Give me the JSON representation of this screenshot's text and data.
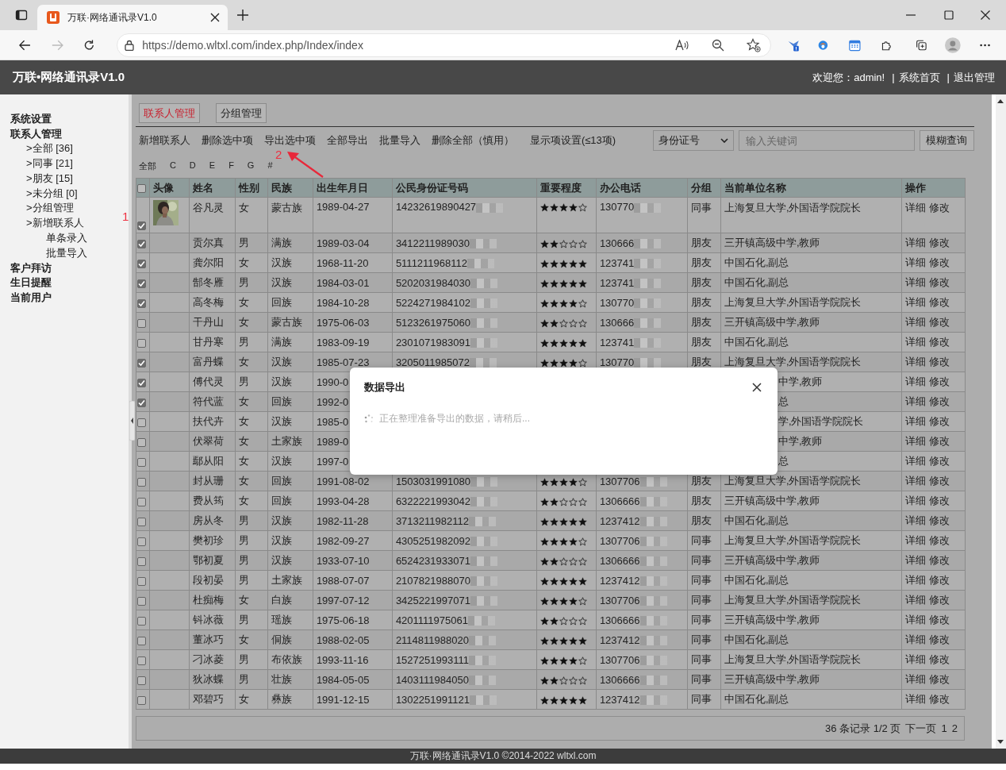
{
  "browser": {
    "tab_title": "万联·网络通讯录V1.0",
    "url": "https://demo.wltxl.com/index.php/Index/index"
  },
  "header": {
    "title": "万联•网络通讯录V1.0",
    "welcome": "欢迎您：admin!",
    "links": [
      {
        "separator": "|",
        "label": "系统首页"
      },
      {
        "separator": "|",
        "label": "退出管理"
      }
    ]
  },
  "sidebar": {
    "sections": [
      {
        "label": "系统设置"
      },
      {
        "label": "联系人管理",
        "children": [
          {
            "label": ">全部 [36]"
          },
          {
            "label": ">同事 [21]"
          },
          {
            "label": ">朋友 [15]"
          },
          {
            "label": ">未分组 [0]"
          },
          {
            "label": ">分组管理"
          },
          {
            "label": ">新增联系人",
            "children": [
              {
                "label": "单条录入"
              },
              {
                "label": "批量导入"
              }
            ]
          }
        ]
      },
      {
        "label": "客户拜访"
      },
      {
        "label": "生日提醒"
      },
      {
        "label": "当前用户"
      }
    ]
  },
  "annotations": [
    {
      "text": "1"
    },
    {
      "text": "2"
    }
  ],
  "tabs": [
    {
      "label": "联系人管理",
      "selected": true
    },
    {
      "label": "分组管理",
      "selected": false
    }
  ],
  "actions": [
    "新增联系人",
    "删除选中项",
    "导出选中项",
    "全部导出",
    "批量导入",
    "删除全部（慎用）",
    "显示项设置(≤13项)"
  ],
  "search": {
    "field": "身份证号",
    "placeholder": "输入关键词",
    "button": "模糊查询"
  },
  "letters": [
    "全部",
    "C",
    "D",
    "E",
    "F",
    "G",
    "#"
  ],
  "table": {
    "select_all": {
      "checked": false
    },
    "columns": [
      "头像",
      "姓名",
      "性别",
      "民族",
      "出生年月日",
      "公民身份证号码",
      "重要程度",
      "办公电话",
      "分组",
      "当前单位名称",
      "操作"
    ],
    "rows": [
      {
        "checked": true,
        "name": "谷凡灵",
        "gender": "女",
        "ethnicity": "蒙古族",
        "birth": "1989-04-27",
        "id_number": "14232619890427",
        "stars": 4,
        "phone": "130770",
        "group": "同事",
        "unit": "上海复旦大学,外国语学院院长",
        "actions": [
          "详细",
          "修改"
        ]
      },
      {
        "checked": true,
        "name": "贡尔真",
        "gender": "男",
        "ethnicity": "满族",
        "birth": "1989-03-04",
        "id_number": "3412211989030",
        "stars": 2,
        "phone": "130666",
        "group": "朋友",
        "unit": "三开镇高级中学,教师",
        "actions": [
          "详细",
          "修改"
        ]
      },
      {
        "checked": true,
        "name": "龚尔阳",
        "gender": "女",
        "ethnicity": "汉族",
        "birth": "1968-11-20",
        "id_number": "5111211968112",
        "stars": 5,
        "phone": "123741",
        "group": "朋友",
        "unit": "中国石化,副总",
        "actions": [
          "详细",
          "修改"
        ]
      },
      {
        "checked": true,
        "name": "郜冬雁",
        "gender": "男",
        "ethnicity": "汉族",
        "birth": "1984-03-01",
        "id_number": "5202031984030",
        "stars": 5,
        "phone": "123741",
        "group": "朋友",
        "unit": "中国石化,副总",
        "actions": [
          "详细",
          "修改"
        ]
      },
      {
        "checked": true,
        "name": "高冬梅",
        "gender": "女",
        "ethnicity": "回族",
        "birth": "1984-10-28",
        "id_number": "5224271984102",
        "stars": 4,
        "phone": "130770",
        "group": "朋友",
        "unit": "上海复旦大学,外国语学院院长",
        "actions": [
          "详细",
          "修改"
        ]
      },
      {
        "checked": false,
        "name": "干丹山",
        "gender": "女",
        "ethnicity": "蒙古族",
        "birth": "1975-06-03",
        "id_number": "5123261975060",
        "stars": 2,
        "phone": "130666",
        "group": "朋友",
        "unit": "三开镇高级中学,教师",
        "actions": [
          "详细",
          "修改"
        ]
      },
      {
        "checked": false,
        "name": "甘丹寒",
        "gender": "男",
        "ethnicity": "满族",
        "birth": "1983-09-19",
        "id_number": "2301071983091",
        "stars": 5,
        "phone": "123741",
        "group": "朋友",
        "unit": "中国石化,副总",
        "actions": [
          "详细",
          "修改"
        ]
      },
      {
        "checked": true,
        "name": "富丹蝶",
        "gender": "女",
        "ethnicity": "汉族",
        "birth": "1985-07-23",
        "id_number": "3205011985072",
        "stars": 4,
        "phone": "130770",
        "group": "朋友",
        "unit": "上海复旦大学,外国语学院院长",
        "actions": [
          "详细",
          "修改"
        ]
      },
      {
        "checked": true,
        "name": "傅代灵",
        "gender": "男",
        "ethnicity": "汉族",
        "birth": "1990-0",
        "unit_tail": "中学,教师",
        "actions": [
          "详细",
          "修改"
        ]
      },
      {
        "checked": true,
        "name": "符代蓝",
        "gender": "女",
        "ethnicity": "回族",
        "birth": "1992-0",
        "unit_tail": "总",
        "actions": [
          "详细",
          "修改"
        ]
      },
      {
        "checked": false,
        "name": "扶代卉",
        "gender": "女",
        "ethnicity": "汉族",
        "birth": "1985-0",
        "unit_tail": "学,外国语学院院长",
        "actions": [
          "详细",
          "修改"
        ]
      },
      {
        "checked": false,
        "name": "伏翠荷",
        "gender": "女",
        "ethnicity": "土家族",
        "birth": "1989-0",
        "unit_tail": "中学,教师",
        "actions": [
          "详细",
          "修改"
        ]
      },
      {
        "checked": false,
        "name": "鄢从阳",
        "gender": "女",
        "ethnicity": "汉族",
        "birth": "1997-0",
        "unit_tail": "总",
        "actions": [
          "详细",
          "修改"
        ]
      },
      {
        "checked": false,
        "name": "封从珊",
        "gender": "女",
        "ethnicity": "回族",
        "birth": "1991-08-02",
        "id_number": "1503031991080",
        "stars": 4,
        "phone": "1307706",
        "group": "朋友",
        "unit": "上海复旦大学,外国语学院院长",
        "actions": [
          "详细",
          "修改"
        ]
      },
      {
        "checked": false,
        "name": "费从筠",
        "gender": "女",
        "ethnicity": "回族",
        "birth": "1993-04-28",
        "id_number": "6322221993042",
        "stars": 2,
        "phone": "1306666",
        "group": "朋友",
        "unit": "三开镇高级中学,教师",
        "actions": [
          "详细",
          "修改"
        ]
      },
      {
        "checked": false,
        "name": "房从冬",
        "gender": "男",
        "ethnicity": "汉族",
        "birth": "1982-11-28",
        "id_number": "3713211982112",
        "stars": 5,
        "phone": "1237412",
        "group": "朋友",
        "unit": "中国石化,副总",
        "actions": [
          "详细",
          "修改"
        ]
      },
      {
        "checked": false,
        "name": "樊初珍",
        "gender": "男",
        "ethnicity": "汉族",
        "birth": "1982-09-27",
        "id_number": "4305251982092",
        "stars": 4,
        "phone": "1307706",
        "group": "同事",
        "unit": "上海复旦大学,外国语学院院长",
        "actions": [
          "详细",
          "修改"
        ]
      },
      {
        "checked": false,
        "name": "鄂初夏",
        "gender": "男",
        "ethnicity": "汉族",
        "birth": "1933-07-10",
        "id_number": "6524231933071",
        "stars": 2,
        "phone": "1306666",
        "group": "同事",
        "unit": "三开镇高级中学,教师",
        "actions": [
          "详细",
          "修改"
        ]
      },
      {
        "checked": false,
        "name": "段初晏",
        "gender": "男",
        "ethnicity": "土家族",
        "birth": "1988-07-07",
        "id_number": "2107821988070",
        "stars": 5,
        "phone": "1237412",
        "group": "同事",
        "unit": "中国石化,副总",
        "actions": [
          "详细",
          "修改"
        ]
      },
      {
        "checked": false,
        "name": "杜痴梅",
        "gender": "女",
        "ethnicity": "白族",
        "birth": "1997-07-12",
        "id_number": "3425221997071",
        "stars": 4,
        "phone": "1307706",
        "group": "同事",
        "unit": "上海复旦大学,外国语学院院长",
        "actions": [
          "详细",
          "修改"
        ]
      },
      {
        "checked": false,
        "name": "钭冰薇",
        "gender": "男",
        "ethnicity": "瑶族",
        "birth": "1975-06-18",
        "id_number": "4201111975061",
        "stars": 2,
        "phone": "1306666",
        "group": "同事",
        "unit": "三开镇高级中学,教师",
        "actions": [
          "详细",
          "修改"
        ]
      },
      {
        "checked": false,
        "name": "董冰巧",
        "gender": "女",
        "ethnicity": "侗族",
        "birth": "1988-02-05",
        "id_number": "2114811988020",
        "stars": 5,
        "phone": "1237412",
        "group": "同事",
        "unit": "中国石化,副总",
        "actions": [
          "详细",
          "修改"
        ]
      },
      {
        "checked": false,
        "name": "刁冰菱",
        "gender": "男",
        "ethnicity": "布依族",
        "birth": "1993-11-16",
        "id_number": "1527251993111",
        "stars": 4,
        "phone": "1307706",
        "group": "同事",
        "unit": "上海复旦大学,外国语学院院长",
        "actions": [
          "详细",
          "修改"
        ]
      },
      {
        "checked": false,
        "name": "狄冰蝶",
        "gender": "男",
        "ethnicity": "壮族",
        "birth": "1984-05-05",
        "id_number": "1403111984050",
        "stars": 2,
        "phone": "1306666",
        "group": "同事",
        "unit": "三开镇高级中学,教师",
        "actions": [
          "详细",
          "修改"
        ]
      },
      {
        "checked": false,
        "name": "邓碧巧",
        "gender": "女",
        "ethnicity": "彝族",
        "birth": "1991-12-15",
        "id_number": "1302251991121",
        "stars": 5,
        "phone": "1237412",
        "group": "同事",
        "unit": "中国石化,副总",
        "actions": [
          "详细",
          "修改"
        ]
      }
    ]
  },
  "pager": {
    "summary": "36 条记录 1/2 页",
    "next": "下一页",
    "pages": [
      "1",
      "2"
    ]
  },
  "dialog": {
    "title": "数据导出",
    "message": "正在整理准备导出的数据，请稍后..."
  },
  "footer": "万联·网络通讯录V1.0 ©2014-2022 wltxl.com"
}
